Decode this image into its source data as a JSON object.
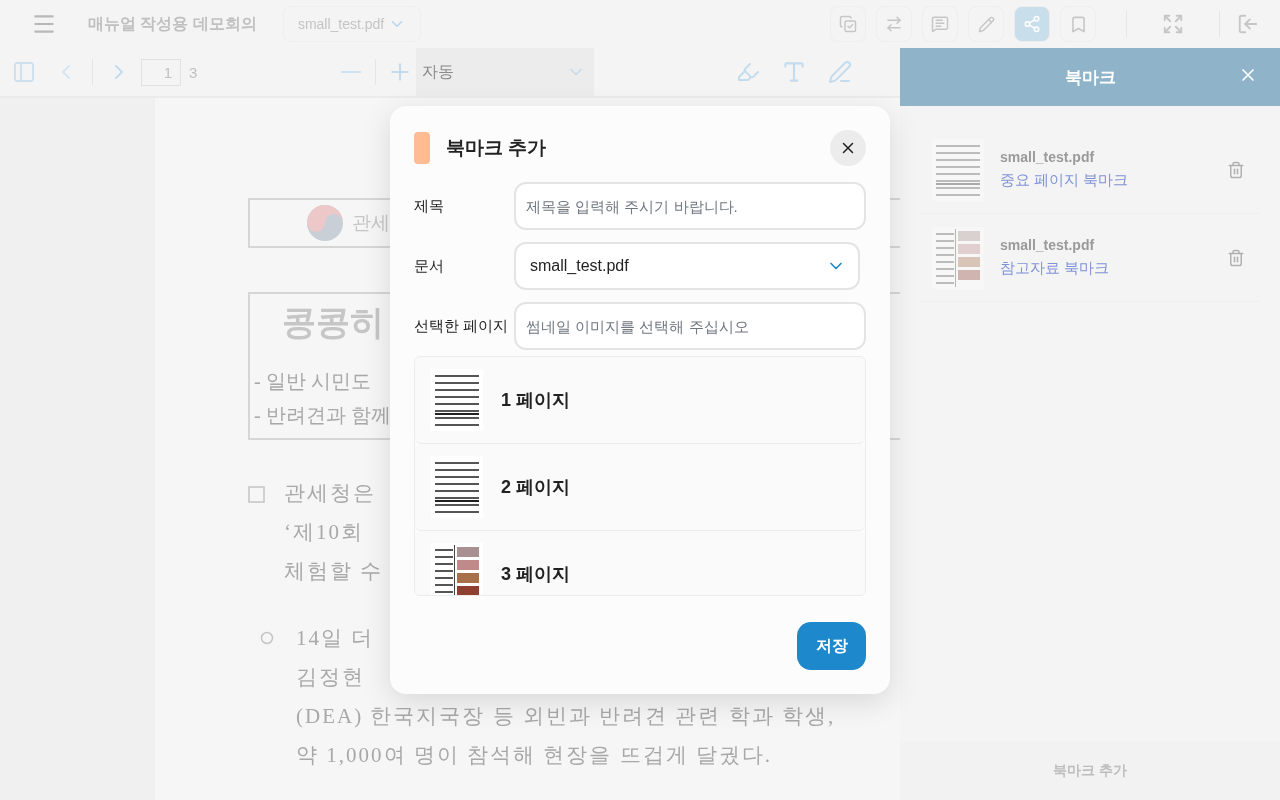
{
  "topbar": {
    "title": "매뉴얼 작성용 데모회의",
    "file": "small_test.pdf",
    "tools": [
      {
        "kind": "copy",
        "selected": false
      },
      {
        "kind": "swap",
        "selected": false
      },
      {
        "kind": "comment",
        "selected": false
      },
      {
        "kind": "pencil",
        "selected": false
      },
      {
        "kind": "share",
        "selected": true
      },
      {
        "kind": "bookmark",
        "selected": false
      }
    ]
  },
  "toolbar": {
    "page": "1",
    "total": "3",
    "zoom": "자동"
  },
  "document": {
    "logo_text": "관세",
    "title": "콩콩히",
    "bullets": [
      "- 일반 시민도",
      "- 반려견과 함께"
    ],
    "paragraphs": [
      {
        "kind": "square",
        "lines": [
          "관세청은",
          "‘제10회",
          "체험할 수"
        ]
      },
      {
        "kind": "circle",
        "lines": [
          "14일 더",
          "김정현",
          "(DEA) 한국지국장 등 외빈과 반려견 관련 학과 학생,",
          "약 1,000여 명이 참석해 현장을 뜨겁게 달궜다."
        ]
      }
    ]
  },
  "bookmarks_panel": {
    "title": "북마크",
    "items": [
      {
        "file": "small_test.pdf",
        "title": "중요 페이지 북마크"
      },
      {
        "file": "small_test.pdf",
        "title": "참고자료 북마크"
      }
    ],
    "add_button": "북마크 추가"
  },
  "dialog": {
    "title": "북마크 추가",
    "fields": [
      {
        "kind": "text",
        "label": "제목",
        "placeholder": "제목을 입력해 주시기 바랍니다."
      },
      {
        "kind": "select",
        "label": "문서",
        "value": "small_test.pdf"
      },
      {
        "kind": "text",
        "label": "선택한 페이지",
        "placeholder": "썸네일 이미지를 선택해 주십시오"
      }
    ],
    "pages": [
      "1 페이지",
      "2 페이지",
      "3 페이지"
    ],
    "save": "저장"
  }
}
